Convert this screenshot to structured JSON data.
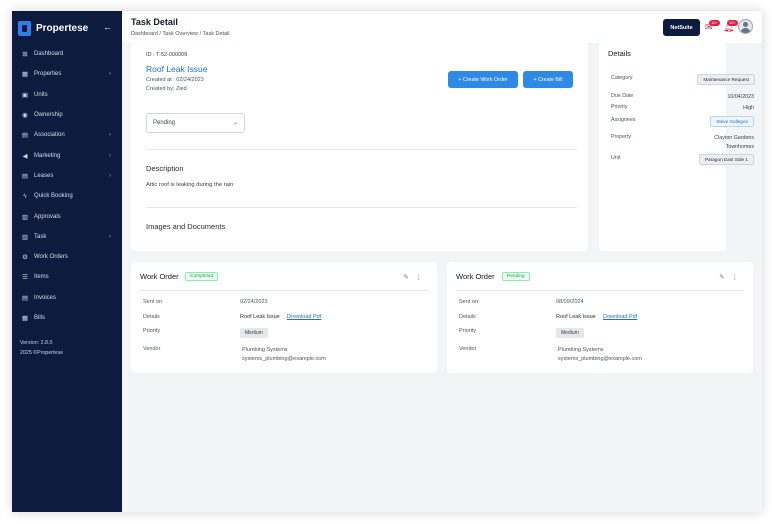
{
  "sidebar": {
    "brand": "Propertese",
    "collapse_icon": "arrow-left-icon",
    "items": [
      {
        "label": "Dashboard",
        "icon": "grid-icon",
        "chevron": ""
      },
      {
        "label": "Properties",
        "icon": "building-icon",
        "chevron": "›"
      },
      {
        "label": "Units",
        "icon": "units-icon",
        "chevron": ""
      },
      {
        "label": "Ownership",
        "icon": "eye-icon",
        "chevron": ""
      },
      {
        "label": "Association",
        "icon": "doc-icon",
        "chevron": "›"
      },
      {
        "label": "Marketing",
        "icon": "megaphone-icon",
        "chevron": "›"
      },
      {
        "label": "Leases",
        "icon": "doc-icon",
        "chevron": "›"
      },
      {
        "label": "Quick Booking",
        "icon": "bolt-icon",
        "chevron": ""
      },
      {
        "label": "Approvals",
        "icon": "clipboard-icon",
        "chevron": ""
      },
      {
        "label": "Task",
        "icon": "clipboard-icon",
        "chevron": "›"
      },
      {
        "label": "Work Orders",
        "icon": "gear-icon",
        "chevron": ""
      },
      {
        "label": "Items",
        "icon": "list-icon",
        "chevron": ""
      },
      {
        "label": "Invoices",
        "icon": "invoice-icon",
        "chevron": ""
      },
      {
        "label": "Bills",
        "icon": "bill-icon",
        "chevron": ""
      }
    ],
    "version": "Version: 2.8.0",
    "copyright": "2025 ©Propertese"
  },
  "header": {
    "title": "Task Detail",
    "breadcrumb": "Dashboard / Task Overview / Task Detail",
    "netsuite_label": "NetSuite",
    "notif_badge_1": "10+",
    "notif_badge_2": "10+"
  },
  "task": {
    "id": "ID : T-52-000009",
    "title": "Roof Leak Issue",
    "created_at": "Created at : 02/24/2023",
    "created_by": "Created by: Zied",
    "create_work_order": "+ Create Work Order",
    "create_bill": "+ Create Bill",
    "status": "Pending",
    "description_heading": "Description",
    "description": "Attic roof is leaking during the rain",
    "images_heading": "Images and Documents"
  },
  "details": {
    "heading": "Details",
    "category_label": "Category",
    "category": "Maintenance Request",
    "due_label": "Due Date",
    "due": "10/04/2023",
    "priority_label": "Priority",
    "priority": "High",
    "assignees_label": "Assignees",
    "assignee": "Steve Gallegos",
    "property_label": "Property",
    "property_line1": "Clayton Gardens",
    "property_line2": "Townhomes",
    "unit_label": "Unit",
    "unit": "Paragon East Side 1"
  },
  "work_orders": [
    {
      "title": "Work Order",
      "status": "Completed",
      "sent_label": "Sent on",
      "sent": "02/24/2023",
      "details_label": "Details",
      "details": "Roof Leak Issue",
      "download": "Download Pdf",
      "priority_label": "Priority",
      "priority": "Medium",
      "vendor_label": "Vendor",
      "vendor_name": "Plumbing Systems",
      "vendor_email": "systems_plumbing@example.com"
    },
    {
      "title": "Work Order",
      "status": "Pending",
      "sent_label": "Sent on",
      "sent": "08/09/2024",
      "details_label": "Details",
      "details": "Roof Leak Issue",
      "download": "Download Pdf",
      "priority_label": "Priority",
      "priority": "Medium",
      "vendor_label": "Vendor",
      "vendor_name": "Plumbing Systems",
      "vendor_email": "systems_plumbing@example.com"
    }
  ]
}
